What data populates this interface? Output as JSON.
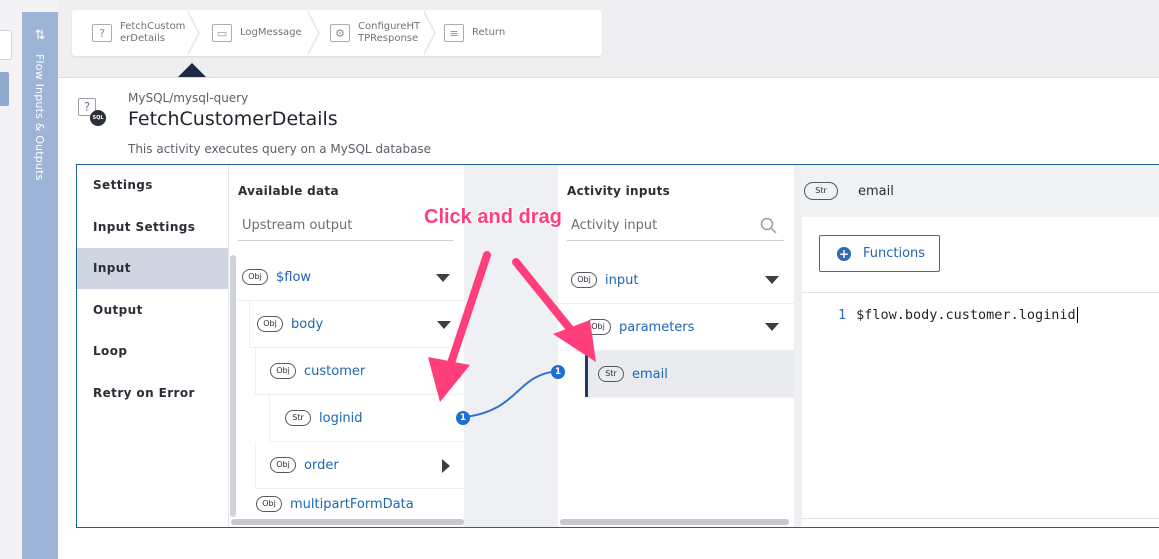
{
  "flow_panel": {
    "label": "Flow Inputs & Outputs",
    "toggle_icon": "swap-arrows-icon"
  },
  "steps": [
    {
      "label": "FetchCustom\nerDetails",
      "icon": "unknown-activity-icon"
    },
    {
      "label": "LogMessage",
      "icon": "log-book-icon"
    },
    {
      "label": "ConfigureHT\nTPResponse",
      "icon": "configure-icon"
    },
    {
      "label": "Return",
      "icon": "return-icon"
    }
  ],
  "activity": {
    "ref": "MySQL/mysql-query",
    "title": "FetchCustomerDetails",
    "description": "This activity executes query on a MySQL database",
    "icon": "mysql-query-icon"
  },
  "tabs": [
    {
      "label": "Settings",
      "active": false
    },
    {
      "label": "Input Settings",
      "active": false
    },
    {
      "label": "Input",
      "active": true
    },
    {
      "label": "Output",
      "active": false
    },
    {
      "label": "Loop",
      "active": false
    },
    {
      "label": "Retry on Error",
      "active": false
    }
  ],
  "available_data": {
    "title": "Available data",
    "search_placeholder": "Upstream output",
    "tree": [
      {
        "type": "Obj",
        "label": "$flow",
        "expander": "down"
      },
      {
        "type": "Obj",
        "label": "body",
        "expander": "down"
      },
      {
        "type": "Obj",
        "label": "customer",
        "expander": "none"
      },
      {
        "type": "Str",
        "label": "loginid",
        "expander": "none"
      },
      {
        "type": "Obj",
        "label": "order",
        "expander": "right"
      },
      {
        "type": "Obj",
        "label": "multipartFormData",
        "expander": "none"
      }
    ]
  },
  "activity_inputs": {
    "title": "Activity inputs",
    "search_placeholder": "Activity input",
    "tree": [
      {
        "type": "Obj",
        "label": "input",
        "expander": "down"
      },
      {
        "type": "Obj",
        "label": "parameters",
        "expander": "down"
      },
      {
        "type": "Str",
        "label": "email",
        "expander": "none",
        "selected": true
      }
    ]
  },
  "editor": {
    "field_type": "Str",
    "field_name": "email",
    "functions_label": "Functions",
    "line_number": "1",
    "expression": "$flow.body.customer.loginid"
  },
  "annotation": {
    "callout": "Click and drag",
    "source_badge": "1",
    "target_badge": "1",
    "color": "#ff3e7c"
  }
}
